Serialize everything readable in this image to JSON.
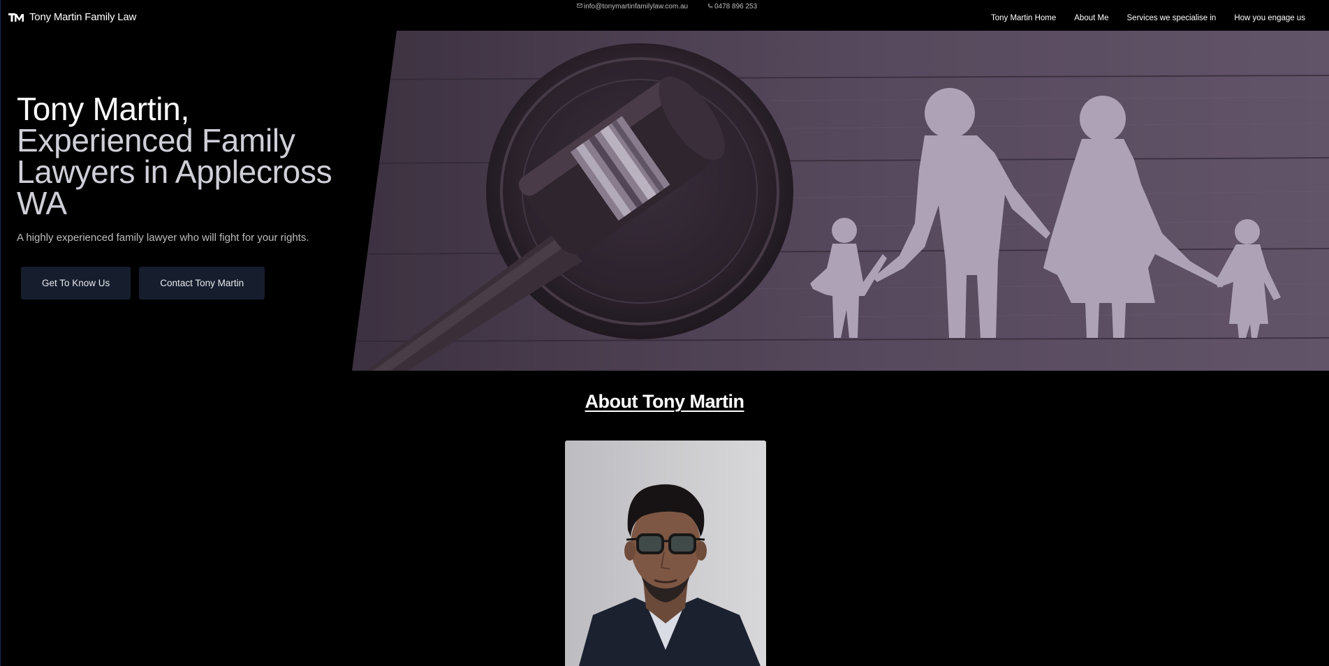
{
  "topbar": {
    "email": "info@tonymartinfamilylaw.com.au",
    "phone": "0478 896 253",
    "email_icon": "mail-icon",
    "phone_icon": "phone-icon"
  },
  "brand": {
    "logo_text": "TM",
    "name": "Tony Martin Family Law"
  },
  "nav": {
    "items": [
      {
        "label": "Tony Martin Home"
      },
      {
        "label": "About Me"
      },
      {
        "label": "Services we specialise in"
      },
      {
        "label": "How you engage us"
      }
    ]
  },
  "hero": {
    "title_line1": "Tony Martin,",
    "title_line2": "Experienced Family Lawyers in Applecross WA",
    "subtitle": "A highly experienced family lawyer who will fight for your rights.",
    "buttons": {
      "primary": "Get To Know Us",
      "secondary": "Contact Tony Martin"
    },
    "image": "gavel-and-paper-family-image"
  },
  "about": {
    "heading": "About Tony Martin",
    "portrait": "tony-martin-portrait"
  },
  "colors": {
    "background": "#000000",
    "button_bg": "#161e2e",
    "hero_tint": "#5a4a60"
  }
}
